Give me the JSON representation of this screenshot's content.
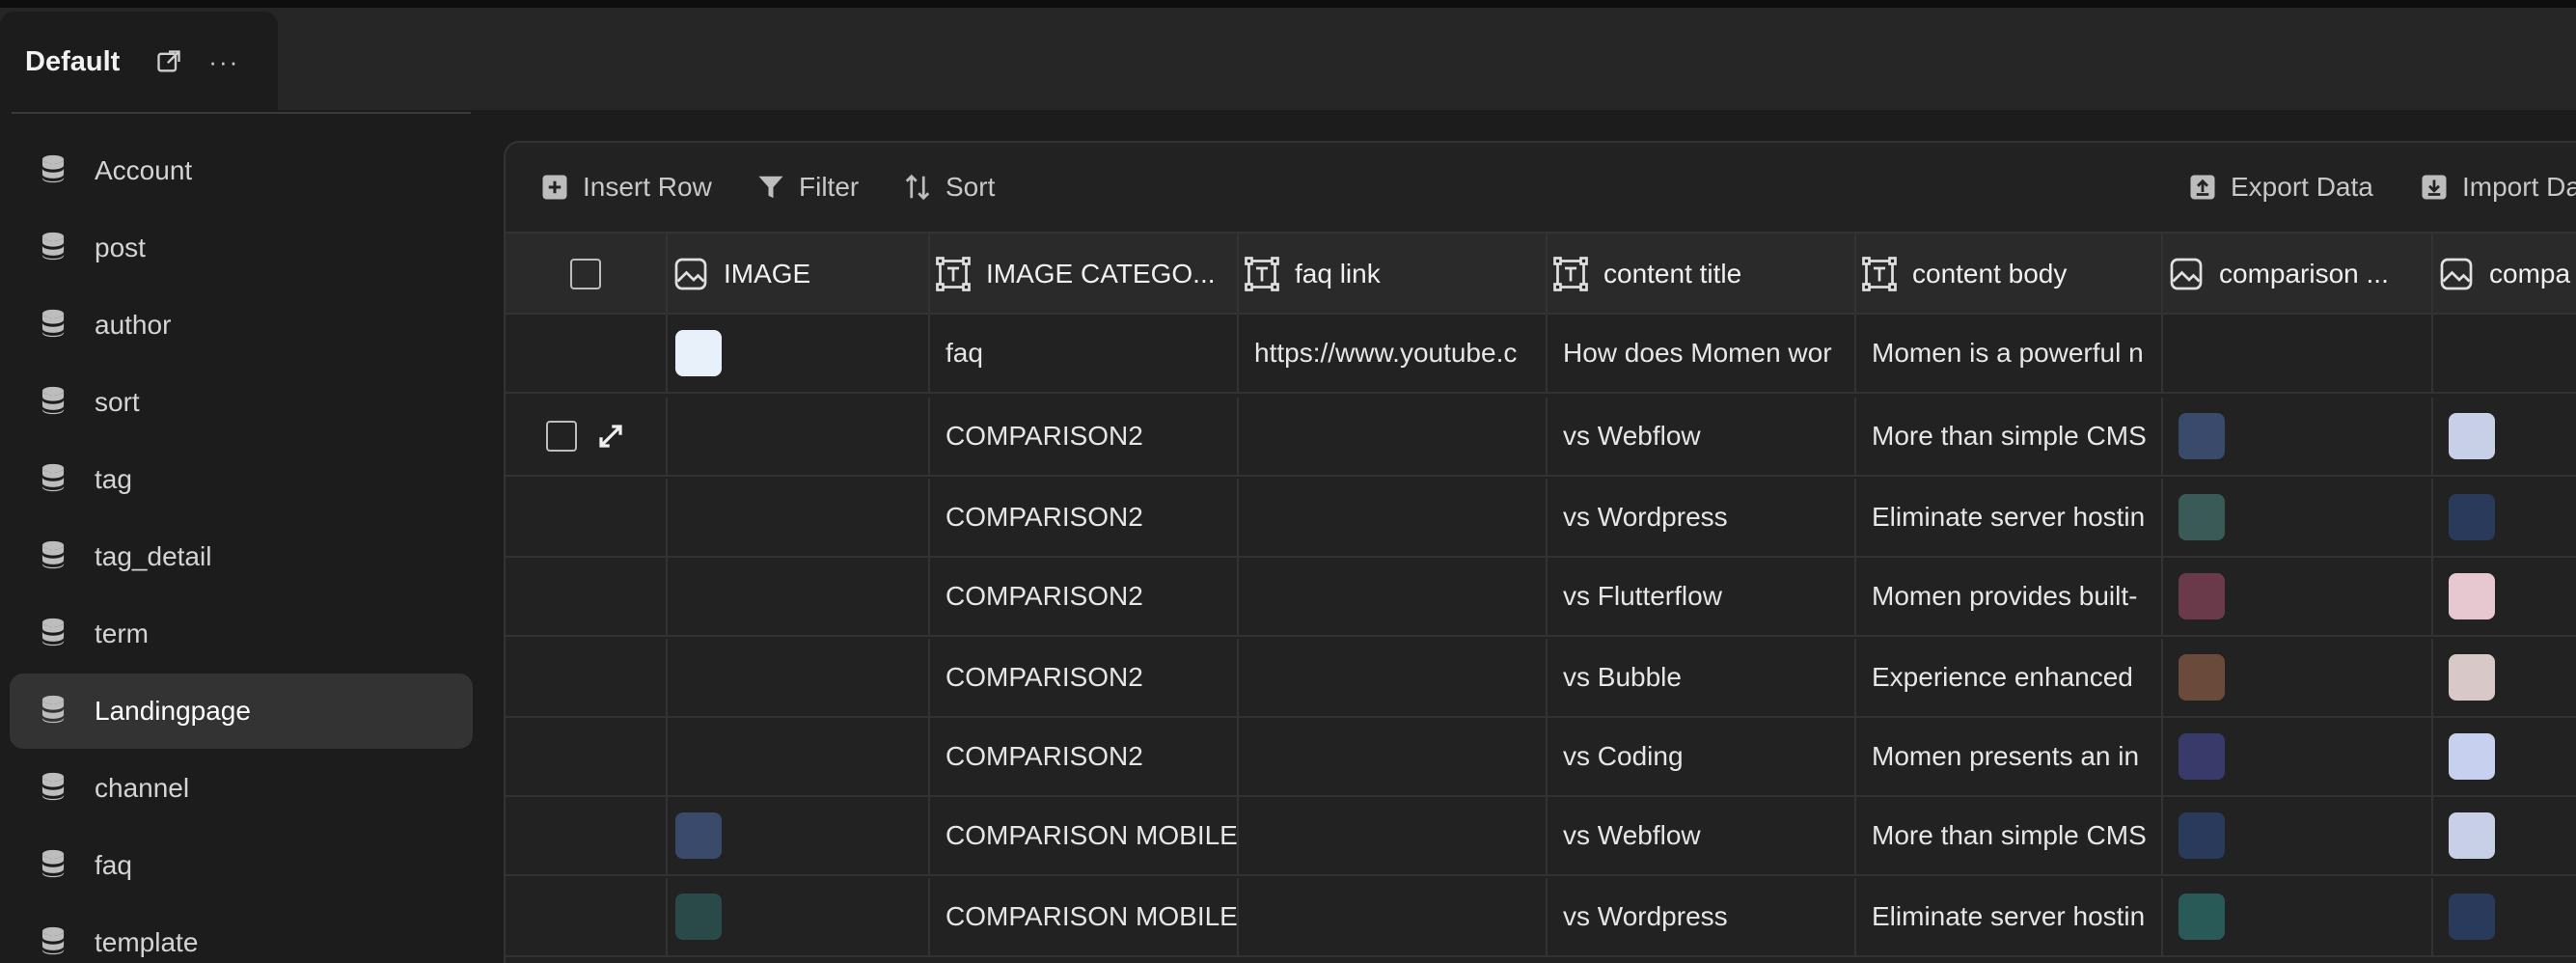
{
  "tab": {
    "title": "Default",
    "open_icon": "external-link-icon",
    "more_label": "···"
  },
  "sidebar": {
    "icon": "database-icon",
    "items": [
      {
        "label": "Account"
      },
      {
        "label": "post"
      },
      {
        "label": "author"
      },
      {
        "label": "sort"
      },
      {
        "label": "tag"
      },
      {
        "label": "tag_detail"
      },
      {
        "label": "term"
      },
      {
        "label": "Landingpage",
        "active": true
      },
      {
        "label": "channel"
      },
      {
        "label": "faq"
      },
      {
        "label": "template"
      }
    ]
  },
  "toolbar": {
    "insert_row": "Insert Row",
    "filter": "Filter",
    "sort": "Sort",
    "export": "Export Data",
    "import": "Import Da"
  },
  "columns": [
    {
      "label": "IMAGE",
      "icon": "image-icon"
    },
    {
      "label": "IMAGE CATEGO...",
      "icon": "text-type-icon"
    },
    {
      "label": "faq link",
      "icon": "text-type-icon"
    },
    {
      "label": "content title",
      "icon": "text-type-icon"
    },
    {
      "label": "content body",
      "icon": "text-type-icon"
    },
    {
      "label": "comparison ...",
      "icon": "image-icon"
    },
    {
      "label": "compa",
      "icon": "image-icon"
    }
  ],
  "rows": [
    {
      "image": "#e8f0fa",
      "category": "faq",
      "faq_link": "https://www.youtube.c",
      "title": "How does Momen wor",
      "body": "Momen is a powerful n",
      "comp1": "",
      "comp2": ""
    },
    {
      "image": "",
      "category": "COMPARISON2",
      "faq_link": "",
      "title": "vs Webflow",
      "body": "More than simple CMS",
      "comp1": "#3a4a6a",
      "comp2": "#c8d0e8",
      "hover": true
    },
    {
      "image": "",
      "category": "COMPARISON2",
      "faq_link": "",
      "title": "vs Wordpress",
      "body": "Eliminate server hostin",
      "comp1": "#3a5a58",
      "comp2": "#2a3a5a"
    },
    {
      "image": "",
      "category": "COMPARISON2",
      "faq_link": "",
      "title": "vs Flutterflow",
      "body": "Momen provides built-",
      "comp1": "#6a3a4a",
      "comp2": "#e8c8d0"
    },
    {
      "image": "",
      "category": "COMPARISON2",
      "faq_link": "",
      "title": "vs Bubble",
      "body": "Experience enhanced",
      "comp1": "#6a4a3a",
      "comp2": "#d8c8c8"
    },
    {
      "image": "",
      "category": "COMPARISON2",
      "faq_link": "",
      "title": "vs Coding",
      "body": "Momen presents an in",
      "comp1": "#3a3a6a",
      "comp2": "#c8d0f0"
    },
    {
      "image": "#3a4a6a",
      "category": "COMPARISON MOBILE",
      "faq_link": "",
      "title": "vs Webflow",
      "body": "More than simple CMS",
      "comp1": "#2a3a5a",
      "comp2": "#c8d0e8"
    },
    {
      "image": "#2a4a4a",
      "category": "COMPARISON MOBILE",
      "faq_link": "",
      "title": "vs Wordpress",
      "body": "Eliminate server hostin",
      "comp1": "#2a5a58",
      "comp2": "#2a3a5a"
    }
  ]
}
